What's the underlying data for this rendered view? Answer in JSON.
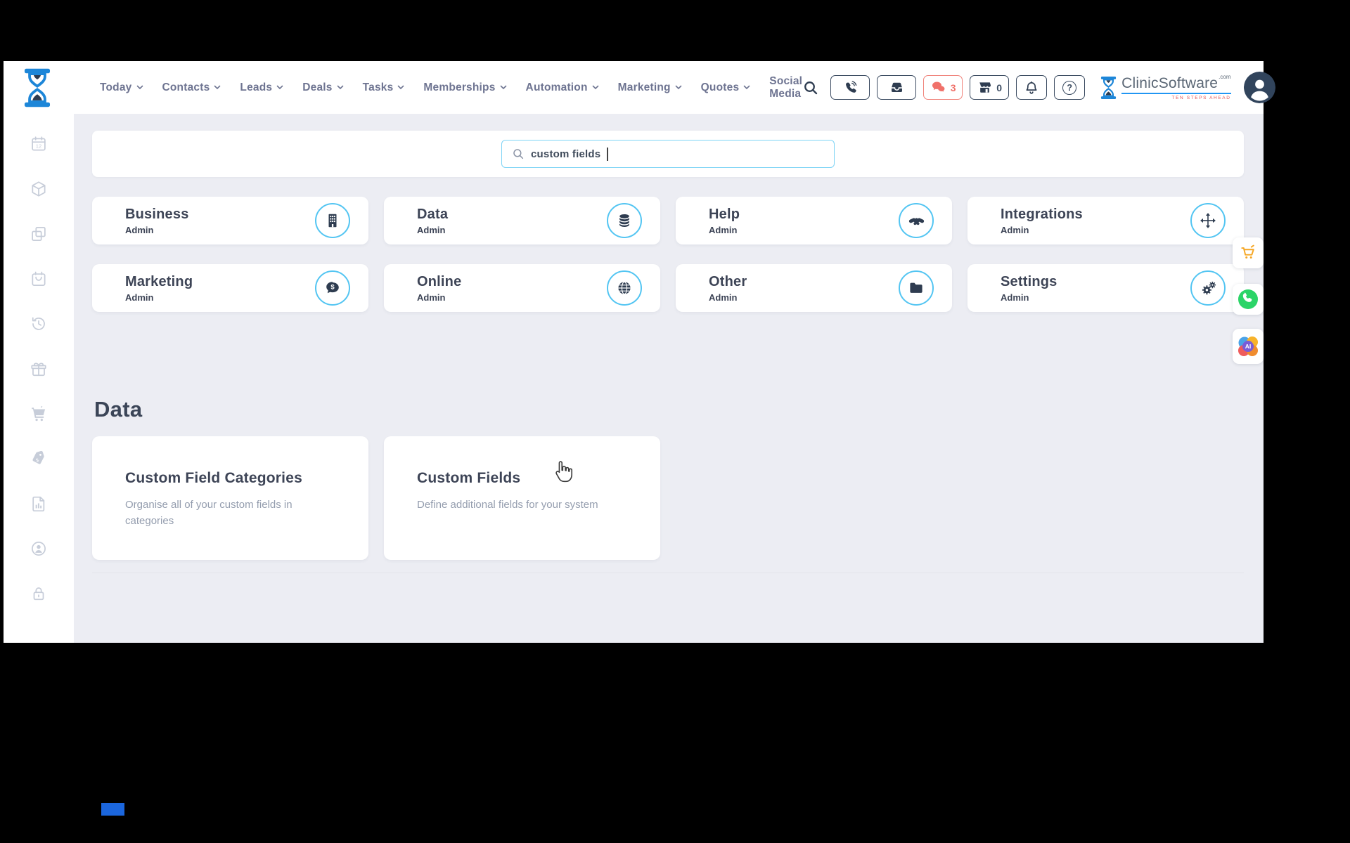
{
  "nav": {
    "items": [
      "Today",
      "Contacts",
      "Leads",
      "Deals",
      "Tasks",
      "Memberships",
      "Automation",
      "Marketing",
      "Quotes",
      "Social Media"
    ]
  },
  "header_actions": {
    "chat_count": "3",
    "store_count": "0",
    "help_label": "?"
  },
  "brand": {
    "name": "ClinicSoftware",
    "tld": ".com",
    "tagline": "TEN STEPS AHEAD"
  },
  "search": {
    "value": "custom fields"
  },
  "categories": [
    {
      "title": "Business",
      "subtitle": "Admin",
      "icon": "building-icon"
    },
    {
      "title": "Data",
      "subtitle": "Admin",
      "icon": "database-icon"
    },
    {
      "title": "Help",
      "subtitle": "Admin",
      "icon": "handshake-icon"
    },
    {
      "title": "Integrations",
      "subtitle": "Admin",
      "icon": "move-arrows-icon"
    },
    {
      "title": "Marketing",
      "subtitle": "Admin",
      "icon": "comment-dollar-icon"
    },
    {
      "title": "Online",
      "subtitle": "Admin",
      "icon": "globe-icon"
    },
    {
      "title": "Other",
      "subtitle": "Admin",
      "icon": "folder-icon"
    },
    {
      "title": "Settings",
      "subtitle": "Admin",
      "icon": "gears-icon"
    }
  ],
  "data_section": {
    "heading": "Data",
    "cards": [
      {
        "title": "Custom Field Categories",
        "description": "Organise all of your custom fields in categories"
      },
      {
        "title": "Custom Fields",
        "description": "Define additional fields for your system"
      }
    ]
  },
  "sidebar": {
    "icons": [
      "calendar",
      "products",
      "duplicates",
      "bookings",
      "history",
      "gifts",
      "cart",
      "pricing",
      "reports",
      "clients",
      "security"
    ]
  },
  "quick_actions": {
    "icons": [
      "cart",
      "whatsapp",
      "ai-assistant"
    ]
  },
  "colors": {
    "accent_blue": "#53c5f2",
    "navy": "#2e3c50",
    "alert_red": "#f0716a",
    "bg": "#ecedf3",
    "sidebar_icon": "#c7cdd9",
    "orange": "#f5a623",
    "whatsapp_green": "#2bd467",
    "logo_blue": "#1d86d8"
  }
}
